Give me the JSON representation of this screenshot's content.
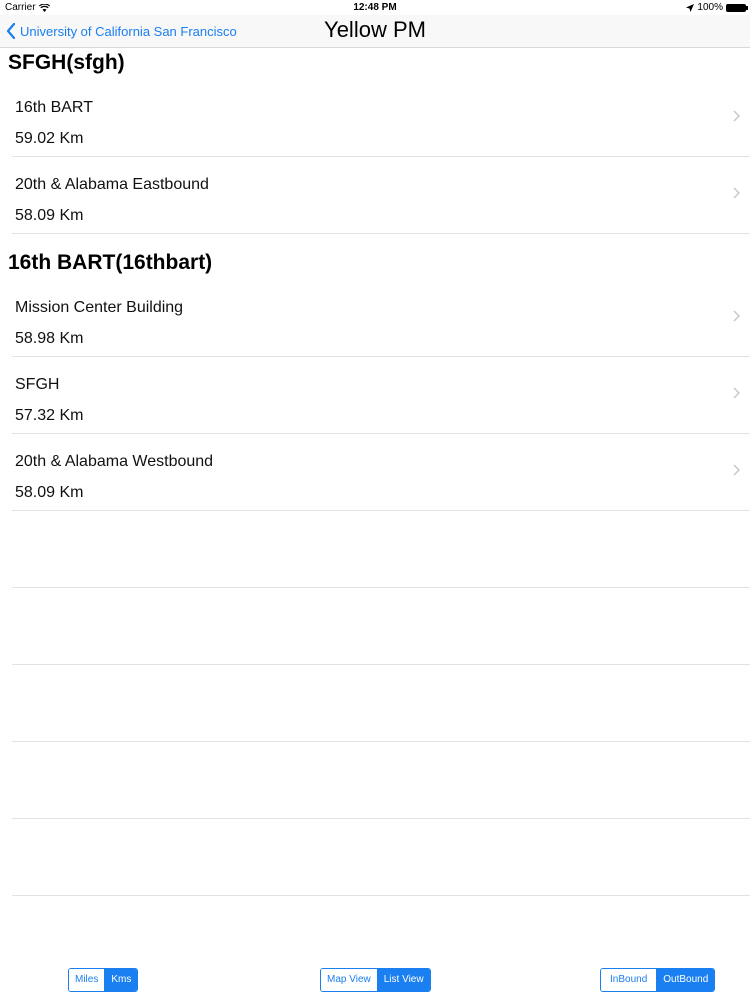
{
  "status_bar": {
    "carrier": "Carrier",
    "time": "12:48 PM",
    "battery": "100%"
  },
  "nav": {
    "back_label": "University of California San Francisco",
    "title": "Yellow PM"
  },
  "sections": [
    {
      "header": "SFGH(sfgh)",
      "rows": [
        {
          "title": "16th BART",
          "distance": "59.02 Km"
        },
        {
          "title": "20th & Alabama Eastbound",
          "distance": "58.09 Km"
        }
      ]
    },
    {
      "header": "16th BART(16thbart)",
      "rows": [
        {
          "title": "Mission Center Building",
          "distance": "58.98 Km"
        },
        {
          "title": "SFGH",
          "distance": "57.32 Km"
        },
        {
          "title": "20th & Alabama Westbound",
          "distance": "58.09 Km"
        }
      ]
    }
  ],
  "toolbar": {
    "units": {
      "miles": "Miles",
      "kms": "Kms",
      "selected": "kms"
    },
    "view": {
      "map": "Map View",
      "list": "List View",
      "selected": "list"
    },
    "direction": {
      "inbound": "InBound",
      "outbound": "OutBound",
      "selected": "outbound"
    }
  },
  "colors": {
    "accent": "#1a7ff0"
  }
}
